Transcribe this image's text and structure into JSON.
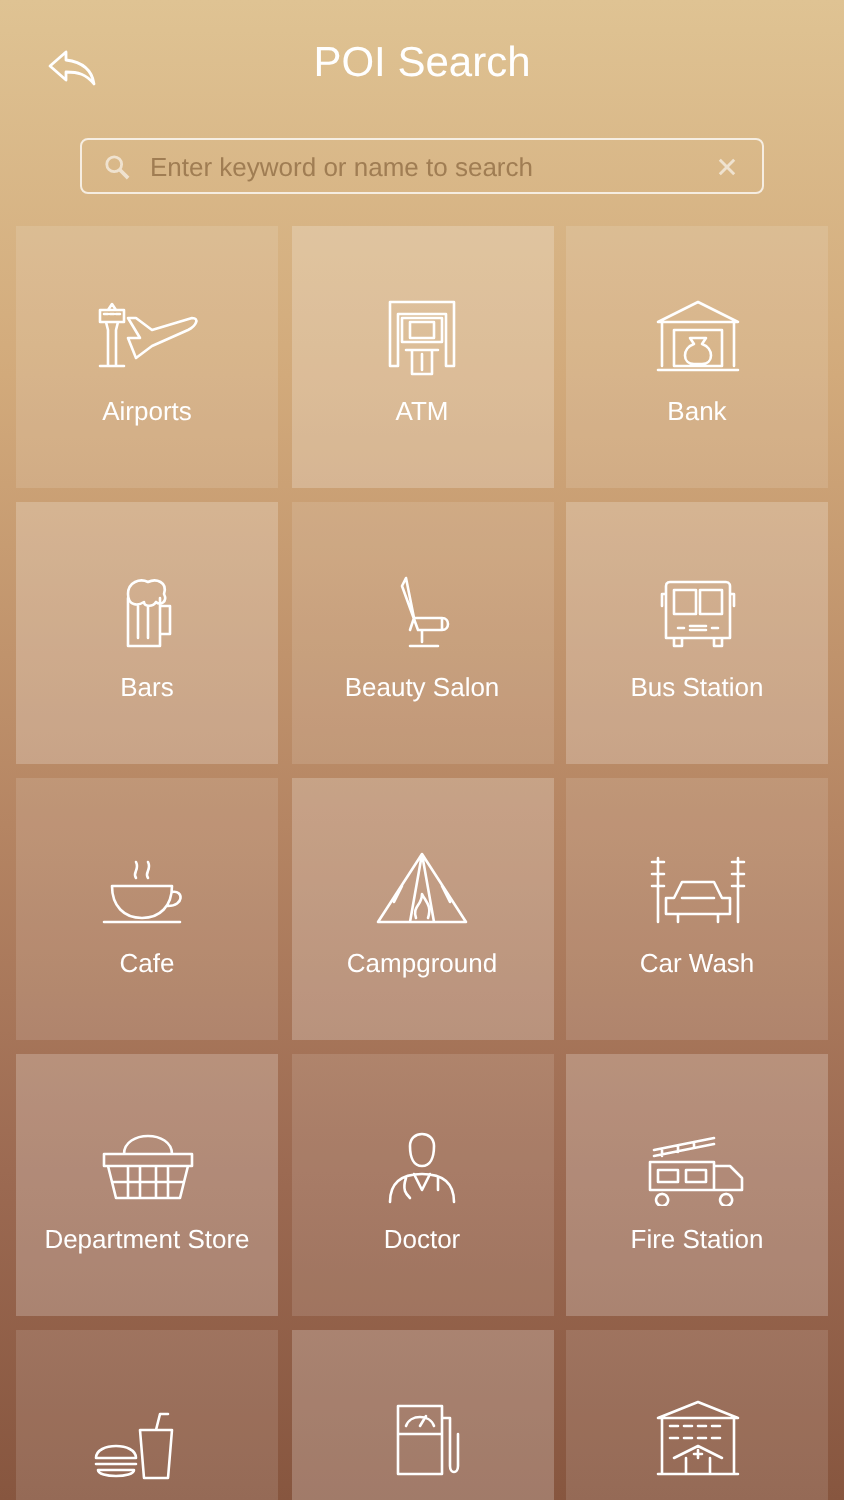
{
  "header": {
    "title": "POI Search"
  },
  "search": {
    "placeholder": "Enter keyword or name to search"
  },
  "categories": [
    {
      "kind": "airport",
      "label": "Airports"
    },
    {
      "kind": "atm",
      "label": "ATM"
    },
    {
      "kind": "bank",
      "label": "Bank"
    },
    {
      "kind": "bar",
      "label": "Bars"
    },
    {
      "kind": "salon",
      "label": "Beauty Salon"
    },
    {
      "kind": "bus",
      "label": "Bus Station"
    },
    {
      "kind": "cafe",
      "label": "Cafe"
    },
    {
      "kind": "camp",
      "label": "Campground"
    },
    {
      "kind": "carwash",
      "label": "Car Wash"
    },
    {
      "kind": "store",
      "label": "Department Store"
    },
    {
      "kind": "doctor",
      "label": "Doctor"
    },
    {
      "kind": "fire",
      "label": "Fire Station"
    },
    {
      "kind": "food"
    },
    {
      "kind": "gas"
    },
    {
      "kind": "hospital"
    }
  ]
}
